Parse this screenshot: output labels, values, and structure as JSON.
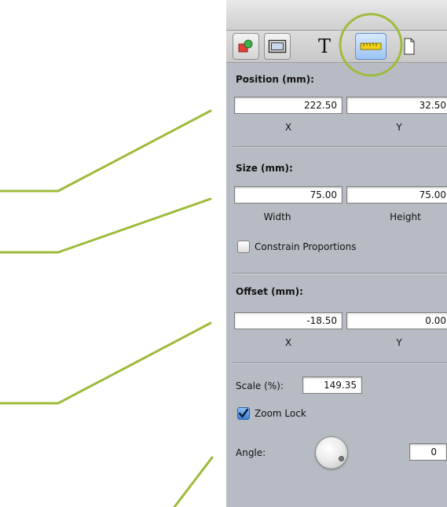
{
  "toolbar": {
    "tabs": [
      {
        "name": "shapes-icon",
        "active": false
      },
      {
        "name": "frame-icon",
        "active": false
      },
      {
        "name": "text-tool",
        "label": "T",
        "active": false
      },
      {
        "name": "ruler-icon",
        "active": true
      },
      {
        "name": "page-icon",
        "active": false
      }
    ]
  },
  "position": {
    "heading": "Position (mm):",
    "x_value": "222.50",
    "y_value": "32.50",
    "x_label": "X",
    "y_label": "Y"
  },
  "size": {
    "heading": "Size (mm):",
    "width_value": "75.00",
    "height_value": "75.00",
    "width_label": "Width",
    "height_label": "Height",
    "constrain_label": "Constrain Proportions",
    "constrain_checked": false
  },
  "offset": {
    "heading": "Offset (mm):",
    "x_value": "-18.50",
    "y_value": "0.00",
    "x_label": "X",
    "y_label": "Y"
  },
  "scale": {
    "label": "Scale (%):",
    "value": "149.35"
  },
  "zoom_lock": {
    "label": "Zoom Lock",
    "checked": true
  },
  "angle": {
    "label": "Angle:",
    "value": "0"
  },
  "colors": {
    "callout_line": "#9dbb3b",
    "panel_bg": "#b7bcc4",
    "active_tab": "#9cc4f4"
  }
}
